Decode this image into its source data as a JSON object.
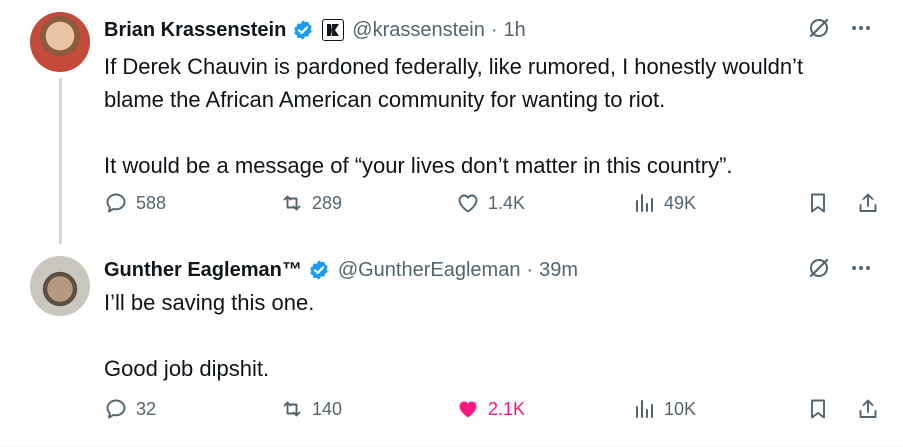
{
  "tweets": [
    {
      "author": {
        "name": "Brian Krassenstein",
        "handle": "@krassenstein",
        "time": "1h"
      },
      "paragraphs": [
        "If Derek Chauvin is pardoned federally, like rumored, I honestly wouldn’t",
        "blame the African American community for wanting to riot.",
        "",
        "It would be a message of “your lives don’t matter in this country”."
      ],
      "stats": {
        "replies": "588",
        "reposts": "289",
        "likes": "1.4K",
        "views": "49K"
      },
      "liked": false
    },
    {
      "author": {
        "name": "Gunther Eagleman™",
        "handle": "@GuntherEagleman",
        "time": "39m"
      },
      "paragraphs": [
        "I’ll be saving this one.",
        "",
        "Good job dipshit."
      ],
      "stats": {
        "replies": "32",
        "reposts": "140",
        "likes": "2.1K",
        "views": "10K"
      },
      "liked": true
    }
  ],
  "colors": {
    "verified": "#1d9bf0",
    "liked": "#f91880",
    "muted": "#536471",
    "text": "#0f1419"
  },
  "icons": [
    "verified-badge-icon",
    "affiliate-badge-icon",
    "grok-icon",
    "more-icon",
    "reply-icon",
    "repost-icon",
    "like-icon",
    "views-icon",
    "bookmark-icon",
    "share-icon"
  ]
}
